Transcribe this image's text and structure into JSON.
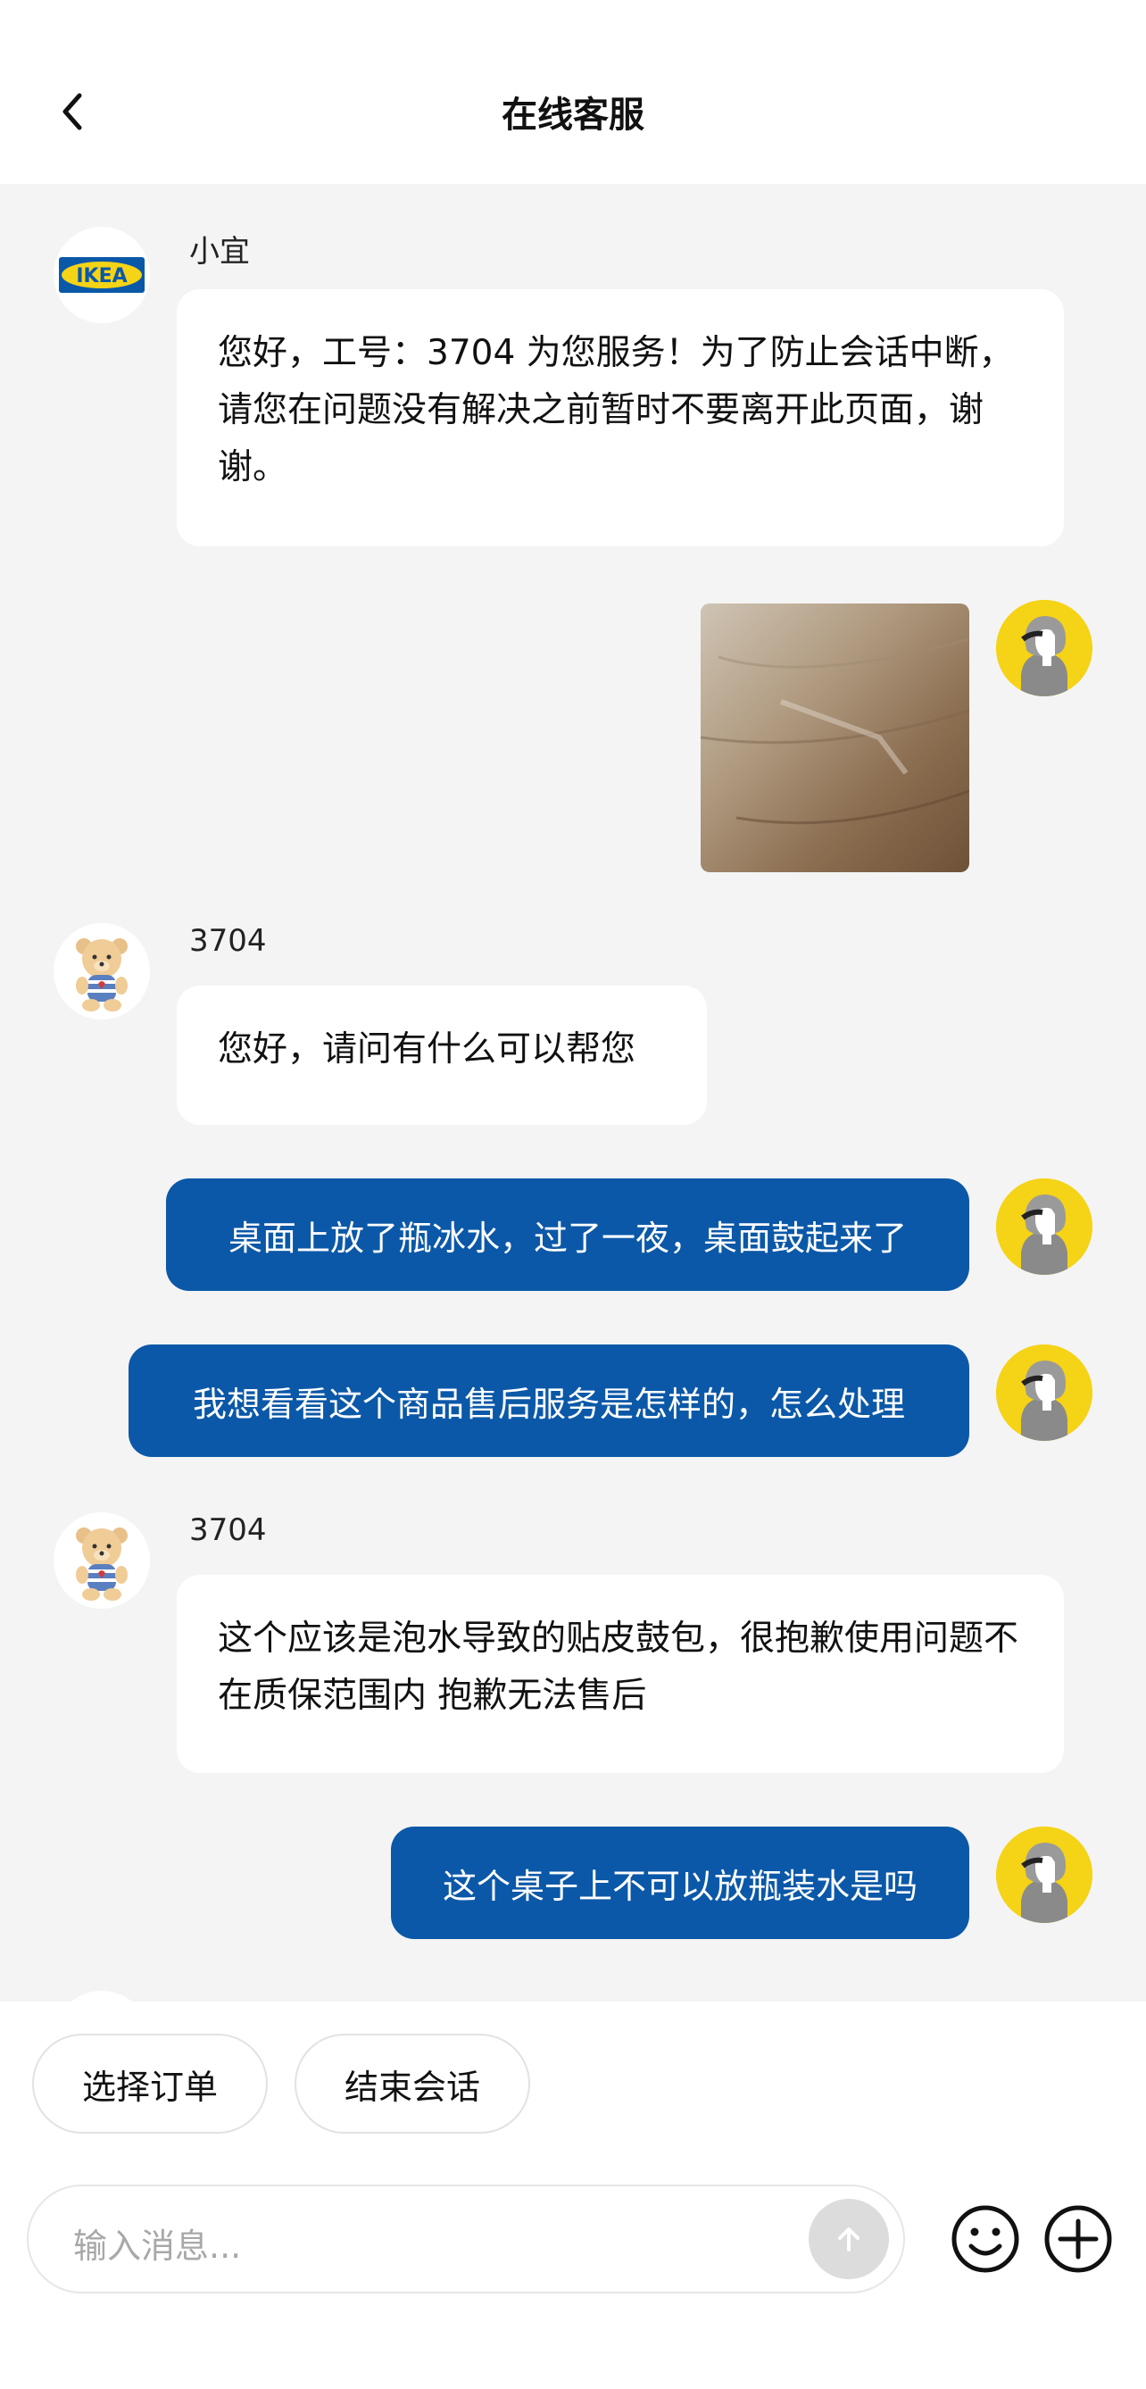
{
  "header": {
    "title": "在线客服",
    "back_icon": "chevron-left-icon"
  },
  "messages": [
    {
      "id": "m1",
      "direction": "incoming",
      "sender": "小宜",
      "avatar": "ikea-logo",
      "text": "您好，工号：3704 为您服务！为了防止会话中断，请您在问题没有解决之前暂时不要离开此页面，谢谢。"
    },
    {
      "id": "m2",
      "direction": "outgoing",
      "type": "image",
      "image_description": "wooden tabletop photo",
      "avatar": "user-avatar"
    },
    {
      "id": "m3",
      "direction": "incoming",
      "sender": "3704",
      "avatar": "teddy-bear-avatar",
      "text": "您好，请问有什么可以帮您"
    },
    {
      "id": "m4",
      "direction": "outgoing",
      "avatar": "user-avatar",
      "text": "桌面上放了瓶冰水，过了一夜，桌面鼓起来了"
    },
    {
      "id": "m5",
      "direction": "outgoing",
      "avatar": "user-avatar",
      "text": "我想看看这个商品售后服务是怎样的，怎么处理"
    },
    {
      "id": "m6",
      "direction": "incoming",
      "sender": "3704",
      "avatar": "teddy-bear-avatar",
      "text": "这个应该是泡水导致的贴皮鼓包，很抱歉使用问题不在质保范围内 抱歉无法售后"
    },
    {
      "id": "m7",
      "direction": "outgoing",
      "avatar": "user-avatar",
      "text": "这个桌子上不可以放瓶装水是吗"
    }
  ],
  "quick_actions": [
    "选择订单",
    "结束会话"
  ],
  "composer": {
    "placeholder": "输入消息...",
    "send_icon": "arrow-up-icon",
    "emoji_icon": "smiley-icon",
    "more_icon": "plus-circle-icon"
  },
  "colors": {
    "outgoing_bubble": "#0b58a8",
    "incoming_bubble": "#ffffff",
    "chat_background": "#f4f4f4",
    "user_avatar": "#f5d316"
  }
}
